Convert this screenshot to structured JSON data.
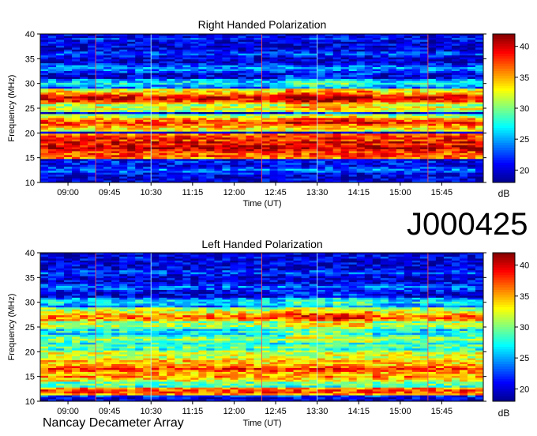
{
  "observation_id": "J000425",
  "footer_text": "Nancay Decameter Array",
  "colormap": [
    "#00008f",
    "#0000ff",
    "#0080ff",
    "#00ffff",
    "#80ff80",
    "#ffff00",
    "#ff8000",
    "#ff0000",
    "#800000"
  ],
  "chart_data": [
    {
      "type": "heatmap",
      "title": "Right Handed Polarization",
      "xlabel": "Time (UT)",
      "ylabel": "Frequency (MHz)",
      "x_ticks": [
        "09:00",
        "09:45",
        "10:30",
        "11:15",
        "12:00",
        "12:45",
        "13:30",
        "14:15",
        "15:00",
        "15:45"
      ],
      "y_ticks": [
        "10",
        "15",
        "20",
        "25",
        "30",
        "35",
        "40"
      ],
      "ylim": [
        10,
        40
      ],
      "colorbar": {
        "unit": "dB",
        "ticks": [
          "20",
          "25",
          "30",
          "35",
          "40"
        ],
        "range": [
          18,
          42
        ]
      },
      "bands_mhz": [
        {
          "freq": 11.0,
          "level": 16
        },
        {
          "freq": 12.5,
          "level": 24
        },
        {
          "freq": 14.0,
          "level": 22
        },
        {
          "freq": 15.5,
          "level": 38
        },
        {
          "freq": 17.0,
          "level": 41
        },
        {
          "freq": 18.0,
          "level": 40
        },
        {
          "freq": 19.0,
          "level": 39
        },
        {
          "freq": 21.0,
          "level": 34
        },
        {
          "freq": 22.0,
          "level": 38
        },
        {
          "freq": 23.0,
          "level": 32
        },
        {
          "freq": 25.0,
          "level": 33
        },
        {
          "freq": 26.5,
          "level": 36
        },
        {
          "freq": 27.0,
          "level": 40
        },
        {
          "freq": 28.0,
          "level": 35
        },
        {
          "freq": 30.0,
          "level": 27
        },
        {
          "freq": 33.0,
          "level": 25
        },
        {
          "freq": 36.0,
          "level": 23
        },
        {
          "freq": 39.0,
          "level": 22
        }
      ],
      "time_lines": [
        "09:30",
        "10:30",
        "12:30",
        "13:30",
        "15:30"
      ]
    },
    {
      "type": "heatmap",
      "title": "Left Handed Polarization",
      "xlabel": "Time (UT)",
      "ylabel": "Frequency (MHz)",
      "x_ticks": [
        "09:00",
        "09:45",
        "10:30",
        "11:15",
        "12:00",
        "12:45",
        "13:30",
        "14:15",
        "15:00",
        "15:45"
      ],
      "y_ticks": [
        "10",
        "15",
        "20",
        "25",
        "30",
        "35",
        "40"
      ],
      "ylim": [
        10,
        40
      ],
      "colorbar": {
        "unit": "dB",
        "ticks": [
          "20",
          "25",
          "30",
          "35",
          "40"
        ],
        "range": [
          18,
          42
        ]
      },
      "bands_mhz": [
        {
          "freq": 11.0,
          "level": 22
        },
        {
          "freq": 12.0,
          "level": 38
        },
        {
          "freq": 13.5,
          "level": 30
        },
        {
          "freq": 15.0,
          "level": 36
        },
        {
          "freq": 16.5,
          "level": 38
        },
        {
          "freq": 18.0,
          "level": 35
        },
        {
          "freq": 19.5,
          "level": 33
        },
        {
          "freq": 21.0,
          "level": 30
        },
        {
          "freq": 22.5,
          "level": 31
        },
        {
          "freq": 24.0,
          "level": 28
        },
        {
          "freq": 25.5,
          "level": 32
        },
        {
          "freq": 27.0,
          "level": 37
        },
        {
          "freq": 28.0,
          "level": 33
        },
        {
          "freq": 30.0,
          "level": 27
        },
        {
          "freq": 33.0,
          "level": 24
        },
        {
          "freq": 36.0,
          "level": 23
        },
        {
          "freq": 39.0,
          "level": 21
        }
      ],
      "time_lines": [
        "09:30",
        "10:30",
        "12:30",
        "13:30",
        "15:30"
      ]
    }
  ]
}
